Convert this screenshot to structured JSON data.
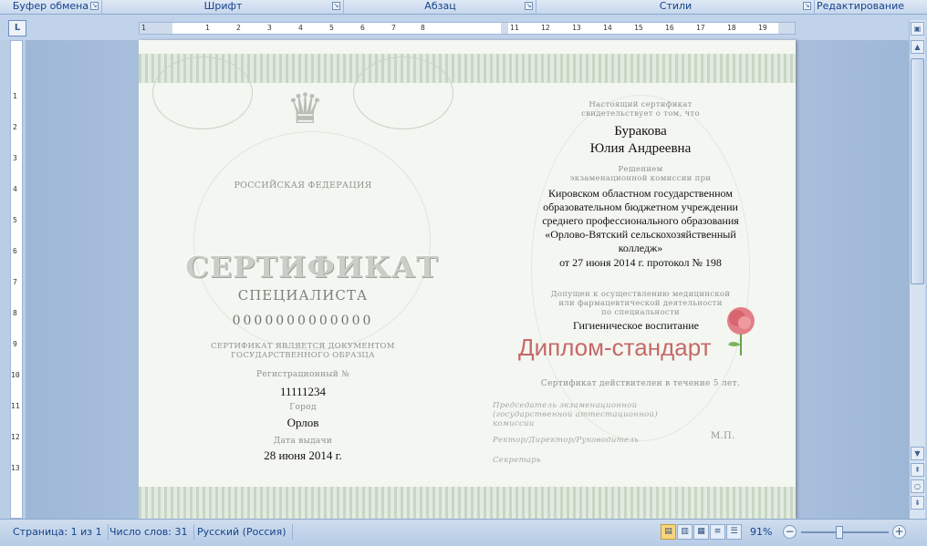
{
  "ribbon": {
    "groups": [
      "Буфер обмена",
      "Шрифт",
      "Абзац",
      "Стили",
      "Редактирование"
    ]
  },
  "ruler": {
    "corner": "L",
    "h_ticks": [
      "1",
      "1",
      "2",
      "3",
      "4",
      "5",
      "6",
      "7",
      "8",
      "11",
      "12",
      "13",
      "14",
      "15",
      "16",
      "17",
      "18",
      "19"
    ],
    "v_ticks": [
      "1",
      "2",
      "3",
      "4",
      "5",
      "6",
      "7",
      "8",
      "9",
      "10",
      "11",
      "12",
      "13"
    ]
  },
  "certificate": {
    "country": "РОССИЙСКАЯ ФЕДЕРАЦИЯ",
    "title": "СЕРТИФИКАТ",
    "subtitle": "СПЕЦИАЛИСТА",
    "number": "0000000000000",
    "doc_note_1": "СЕРТИФИКАТ ЯВЛЯЕТСЯ ДОКУМЕНТОМ",
    "doc_note_2": "ГОСУДАРСТВЕННОГО ОБРАЗЦА",
    "reg_label": "Регистрационный №",
    "reg_value": "11111234",
    "city_label": "Город",
    "city_value": "Орлов",
    "date_label": "Дата выдачи",
    "date_value": "28 июня 2014 г.",
    "attest_1": "Настоящий сертификат",
    "attest_2": "свидетельствует о том, что",
    "surname": "Буракова",
    "given_names": "Юлия Андреевна",
    "decision_1": "Решением",
    "decision_2": "экзаменационной комиссии при",
    "org_1": "Кировском областном государственном",
    "org_2": "образовательном бюджетном учреждении",
    "org_3": "среднего профессионального образования",
    "org_4": "«Орлово-Вятский сельскохозяйственный",
    "org_5": "колледж»",
    "protocol": "от 27 июня 2014 г. протокол № 198",
    "admit_1": "Допущен к осуществлению медицинской",
    "admit_2": "или фармацевтической деятельности",
    "admit_3": "по специальности",
    "specialty": "Гигиеническое воспитание",
    "watermark": "Диплом-стандарт",
    "validity": "Сертификат действителен в течение 5 лет.",
    "chair_1": "Председатель экзаменационной",
    "chair_2": "(государственной аттестационной)",
    "chair_3": "комиссии",
    "rector": "Ректор/Директор/Руководитель",
    "stamp": "М.П.",
    "secretary": "Секретарь"
  },
  "statusbar": {
    "page": "Страница: 1 из 1",
    "words": "Число слов: 31",
    "language": "Русский (Россия)",
    "zoom": "91%",
    "zoom_out": "−",
    "zoom_in": "+"
  },
  "colors": {
    "accent": "#15428b",
    "watermark": "#c0504d"
  }
}
